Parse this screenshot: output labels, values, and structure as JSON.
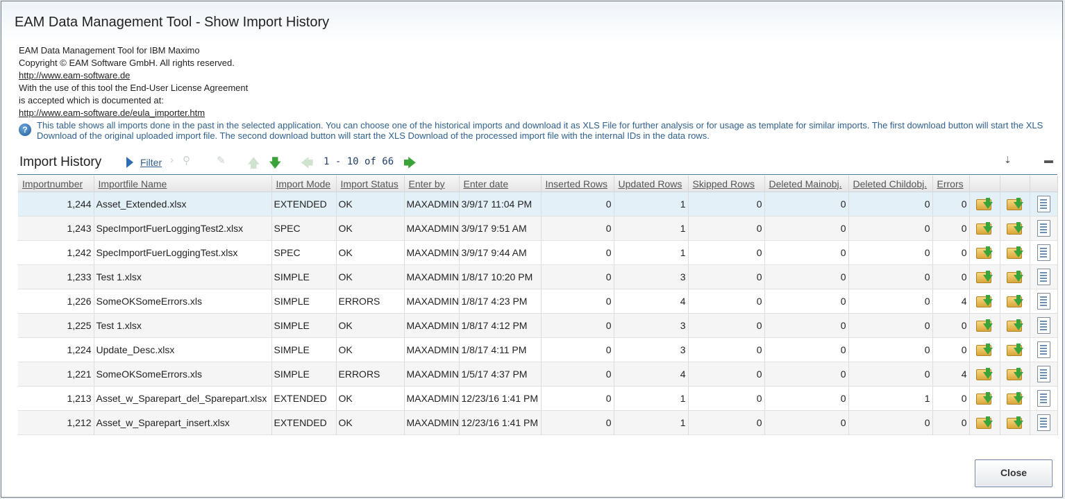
{
  "window": {
    "title": "EAM Data Management Tool - Show Import History"
  },
  "info": {
    "line1": "EAM Data Management Tool for IBM Maximo",
    "line2": "Copyright © EAM Software GmbH. All rights reserved.",
    "link1": "http://www.eam-software.de",
    "line3": "With the use of this tool the End-User License Agreement",
    "line4": "is accepted which is documented at:",
    "link2": "http://www.eam-software.de/eula_importer.htm"
  },
  "help": {
    "text": "This table shows all imports done in the past in the selected application. You can choose one of the historical imports and download it as XLS File for further analysis or for usage as template for similar imports. The first download button will start the XLS Download of the original uploaded import file. The second download button will start the XLS Download of the processed import file with the internal IDs in the data rows."
  },
  "section": {
    "title": "Import History",
    "filter_label": "Filter",
    "pagination": "1 - 10 of 66"
  },
  "icons": {
    "filter": "filter-triangle-icon",
    "chevron": "chevron-right-icon",
    "search": "search-icon",
    "clear": "eraser-icon",
    "up": "arrow-up-icon",
    "down": "arrow-down-icon",
    "prev": "arrow-left-icon",
    "next": "arrow-right-icon",
    "download_table": "download-table-icon",
    "collapse": "collapse-icon",
    "download_original": "download-original-icon",
    "download_processed": "download-processed-icon",
    "log": "log-document-icon",
    "help": "help-icon"
  },
  "colors": {
    "accent": "#2e5f8e",
    "selected_row": "#e3f0f8",
    "green_arrow": "#3aa33a"
  },
  "table": {
    "columns": [
      "Importnumber",
      "Importfile Name",
      "Import Mode",
      "Import Status",
      "Enter by",
      "Enter date",
      "Inserted Rows",
      "Updated Rows",
      "Skipped Rows",
      "Deleted Mainobj.",
      "Deleted Childobj.",
      "Errors"
    ],
    "rows": [
      [
        "1,244",
        "Asset_Extended.xlsx",
        "EXTENDED",
        "OK",
        "MAXADMIN",
        "3/9/17 11:04 PM",
        "0",
        "1",
        "0",
        "0",
        "0",
        "0"
      ],
      [
        "1,243",
        "SpecImportFuerLoggingTest2.xlsx",
        "SPEC",
        "OK",
        "MAXADMIN",
        "3/9/17 9:51 AM",
        "0",
        "1",
        "0",
        "0",
        "0",
        "0"
      ],
      [
        "1,242",
        "SpecImportFuerLoggingTest.xlsx",
        "SPEC",
        "OK",
        "MAXADMIN",
        "3/9/17 9:44 AM",
        "0",
        "1",
        "0",
        "0",
        "0",
        "0"
      ],
      [
        "1,233",
        "Test 1.xlsx",
        "SIMPLE",
        "OK",
        "MAXADMIN",
        "1/8/17 10:20 PM",
        "0",
        "3",
        "0",
        "0",
        "0",
        "0"
      ],
      [
        "1,226",
        "SomeOKSomeErrors.xls",
        "SIMPLE",
        "ERRORS",
        "MAXADMIN",
        "1/8/17 4:23 PM",
        "0",
        "4",
        "0",
        "0",
        "0",
        "4"
      ],
      [
        "1,225",
        "Test 1.xlsx",
        "SIMPLE",
        "OK",
        "MAXADMIN",
        "1/8/17 4:12 PM",
        "0",
        "3",
        "0",
        "0",
        "0",
        "0"
      ],
      [
        "1,224",
        "Update_Desc.xlsx",
        "SIMPLE",
        "OK",
        "MAXADMIN",
        "1/8/17 4:11 PM",
        "0",
        "3",
        "0",
        "0",
        "0",
        "0"
      ],
      [
        "1,221",
        "SomeOKSomeErrors.xls",
        "SIMPLE",
        "ERRORS",
        "MAXADMIN",
        "1/5/17 4:37 PM",
        "0",
        "4",
        "0",
        "0",
        "0",
        "4"
      ],
      [
        "1,213",
        "Asset_w_Sparepart_del_Sparepart.xlsx",
        "EXTENDED",
        "OK",
        "MAXADMIN",
        "12/23/16 1:41 PM",
        "0",
        "1",
        "0",
        "0",
        "1",
        "0"
      ],
      [
        "1,212",
        "Asset_w_Sparepart_insert.xlsx",
        "EXTENDED",
        "OK",
        "MAXADMIN",
        "12/23/16 1:41 PM",
        "0",
        "1",
        "0",
        "0",
        "0",
        "0"
      ]
    ]
  },
  "buttons": {
    "close": "Close"
  }
}
